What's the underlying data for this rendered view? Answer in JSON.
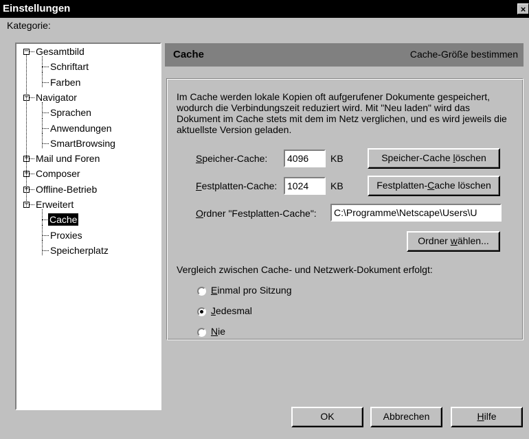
{
  "window": {
    "title": "Einstellungen",
    "close_glyph": "×"
  },
  "category_label": "Kategorie:",
  "tree": {
    "items": [
      {
        "label": "Gesamtbild",
        "level": 0,
        "expander": "−"
      },
      {
        "label": "Schriftart",
        "level": 1
      },
      {
        "label": "Farben",
        "level": 1
      },
      {
        "label": "Navigator",
        "level": 0,
        "expander": "−"
      },
      {
        "label": "Sprachen",
        "level": 1
      },
      {
        "label": "Anwendungen",
        "level": 1
      },
      {
        "label": "SmartBrowsing",
        "level": 1
      },
      {
        "label": "Mail und Foren",
        "level": 0,
        "expander": "+"
      },
      {
        "label": "Composer",
        "level": 0,
        "expander": "+"
      },
      {
        "label": "Offline-Betrieb",
        "level": 0,
        "expander": "+"
      },
      {
        "label": "Erweitert",
        "level": 0,
        "expander": "−"
      },
      {
        "label": "Cache",
        "level": 1,
        "selected": true
      },
      {
        "label": "Proxies",
        "level": 1
      },
      {
        "label": "Speicherplatz",
        "level": 1
      }
    ]
  },
  "panel": {
    "title": "Cache",
    "subtitle": "Cache-Größe bestimmen",
    "description": "Im Cache werden lokale Kopien oft aufgerufener Dokumente gespeichert, wodurch die Verbindungszeit reduziert wird. Mit \"Neu laden\" wird das Dokument im Cache stets mit dem im Netz verglichen, und es wird jeweils die aktuellste Version geladen.",
    "memory_cache": {
      "label_first": "S",
      "label_rest": "peicher-Cache:",
      "value": "4096",
      "unit": "KB",
      "button_pre": "Speicher-Cache ",
      "button_u": "l",
      "button_post": "öschen"
    },
    "disk_cache": {
      "label_first": "F",
      "label_rest": "estplatten-Cache:",
      "value": "1024",
      "unit": "KB",
      "button_pre": "Festplatten-",
      "button_u": "C",
      "button_post": "ache löschen"
    },
    "folder": {
      "label_first": "O",
      "label_rest": "rdner \"Festplatten-Cache\":",
      "value": "C:\\Programme\\Netscape\\Users\\U",
      "button_pre": "Ordner ",
      "button_u": "w",
      "button_post": "ählen..."
    },
    "compare_label": "Vergleich zwischen Cache- und Netzwerk-Dokument erfolgt:",
    "options": [
      {
        "u": "E",
        "rest": "inmal pro Sitzung",
        "checked": false
      },
      {
        "u": "J",
        "rest": "edesmal",
        "checked": true
      },
      {
        "u": "N",
        "rest": "ie",
        "checked": false
      }
    ]
  },
  "buttons": {
    "ok": "OK",
    "cancel": "Abbrechen",
    "help_u": "H",
    "help_rest": "ilfe"
  }
}
